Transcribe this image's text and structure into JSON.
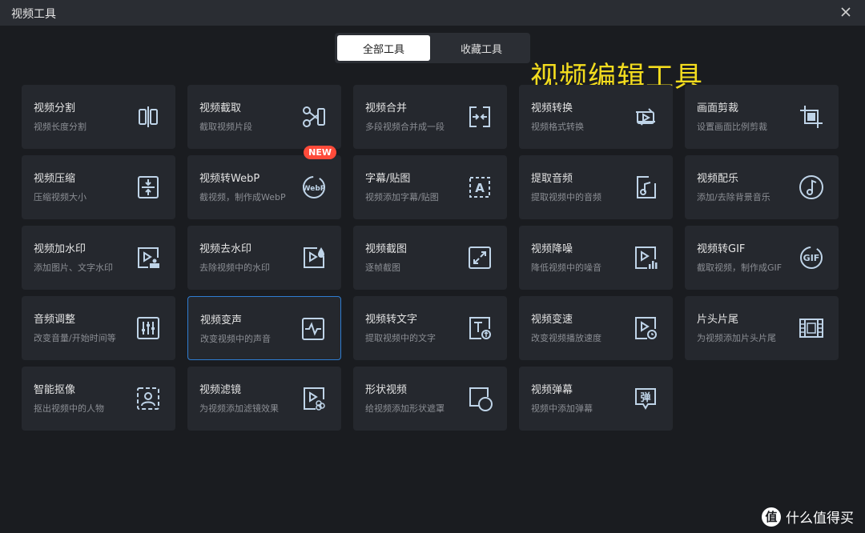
{
  "window": {
    "title": "视频工具"
  },
  "tabs": [
    {
      "label": "全部工具",
      "active": true
    },
    {
      "label": "收藏工具",
      "active": false
    }
  ],
  "annotation": "视频编辑工具",
  "badge_new": "NEW",
  "tools": [
    {
      "title": "视频分割",
      "desc": "视频长度分割",
      "icon": "split-icon"
    },
    {
      "title": "视频截取",
      "desc": "截取视频片段",
      "icon": "scissors-icon"
    },
    {
      "title": "视频合并",
      "desc": "多段视频合并成一段",
      "icon": "merge-icon"
    },
    {
      "title": "视频转换",
      "desc": "视频格式转换",
      "icon": "convert-icon"
    },
    {
      "title": "画面剪裁",
      "desc": "设置画面比例剪裁",
      "icon": "crop-icon"
    },
    {
      "title": "视频压缩",
      "desc": "压缩视频大小",
      "icon": "compress-icon"
    },
    {
      "title": "视频转WebP",
      "desc": "截视频，制作成WebP",
      "icon": "webp-icon"
    },
    {
      "title": "字幕/贴图",
      "desc": "视频添加字幕/贴图",
      "icon": "subtitle-icon"
    },
    {
      "title": "提取音频",
      "desc": "提取视频中的音频",
      "icon": "audio-extract-icon"
    },
    {
      "title": "视频配乐",
      "desc": "添加/去除背景音乐",
      "icon": "music-note-icon"
    },
    {
      "title": "视频加水印",
      "desc": "添加图片、文字水印",
      "icon": "watermark-add-icon"
    },
    {
      "title": "视频去水印",
      "desc": "去除视频中的水印",
      "icon": "watermark-remove-icon"
    },
    {
      "title": "视频截图",
      "desc": "逐帧截图",
      "icon": "screenshot-icon"
    },
    {
      "title": "视频降噪",
      "desc": "降低视频中的噪音",
      "icon": "denoise-icon"
    },
    {
      "title": "视频转GIF",
      "desc": "截取视频，制作成GIF",
      "icon": "gif-icon"
    },
    {
      "title": "音频调整",
      "desc": "改变音量/开始时间等",
      "icon": "equalizer-icon"
    },
    {
      "title": "视频变声",
      "desc": "改变视频中的声音",
      "icon": "voice-change-icon"
    },
    {
      "title": "视频转文字",
      "desc": "提取视频中的文字",
      "icon": "text-extract-icon"
    },
    {
      "title": "视频变速",
      "desc": "改变视频播放速度",
      "icon": "speed-icon"
    },
    {
      "title": "片头片尾",
      "desc": "为视频添加片头片尾",
      "icon": "film-icon"
    },
    {
      "title": "智能抠像",
      "desc": "抠出视频中的人物",
      "icon": "portrait-cutout-icon"
    },
    {
      "title": "视频滤镜",
      "desc": "为视频添加滤镜效果",
      "icon": "filter-icon"
    },
    {
      "title": "形状视频",
      "desc": "给视频添加形状遮罩",
      "icon": "shape-icon"
    },
    {
      "title": "视频弹幕",
      "desc": "视频中添加弹幕",
      "icon": "danmaku-icon"
    }
  ],
  "watermark": {
    "logo": "值",
    "text": "什么值得买"
  },
  "colors": {
    "accent": "#2f7dd1",
    "icon": "#bfd4e8",
    "annotation": "#f3dc1e",
    "badge": "#ff4b3a"
  }
}
